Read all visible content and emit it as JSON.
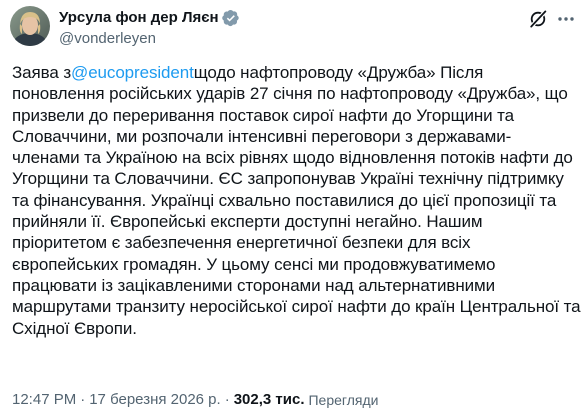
{
  "author": {
    "display_name": "Урсула фон дер Ляєн",
    "handle": "@vonderleyen",
    "verified": true,
    "avatar_icon": "avatar-photo"
  },
  "actions": {
    "grok_icon": "grok-icon",
    "more_icon": "more-icon"
  },
  "post": {
    "lines": [
      {
        "before": "Заява з",
        "mention": "@eucopresident",
        "after": "щодо нафтопроводу «Дружба» Після"
      },
      {
        "text": "поновлення російських ударів 27 січня по нафтопроводу «Дружба», що"
      },
      {
        "text": "призвели до переривання поставок сирої нафти до Угорщини та"
      },
      {
        "text": "Словаччини, ми розпочали інтенсивні переговори з державами-"
      },
      {
        "text": "членами та Україною на всіх рівнях щодо відновлення потоків нафти до"
      },
      {
        "text": "Угорщини та Словаччини. ЄС запропонував Україні технічну підтримку"
      },
      {
        "text": "та фінансування. Українці схвально поставилися до цієї пропозиції та"
      },
      {
        "text": "прийняли її. Європейські експерти доступні негайно. Нашим"
      },
      {
        "text": "пріоритетом є забезпечення енергетичної безпеки для всіх"
      },
      {
        "text": "європейських громадян. У цьому сенсі ми продовжуватимемо"
      },
      {
        "text": "працювати із зацікавленими сторонами над альтернативними"
      },
      {
        "text": "маршрутами транзиту неросійської сирої нафти до країн Центральної та"
      },
      {
        "text": "Східної Європи."
      }
    ]
  },
  "meta": {
    "time": "12:47 PM",
    "separator": "·",
    "date": "17 березня 2026 р.",
    "views_count": "302,3 тис.",
    "views_label": "Перегляди"
  },
  "colors": {
    "text": "#0f1419",
    "secondary": "#536471",
    "accent": "#1d9bf0"
  }
}
